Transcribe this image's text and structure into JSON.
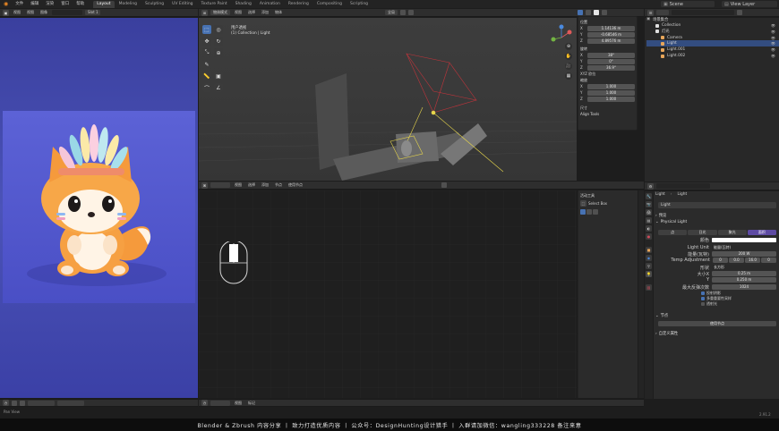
{
  "topbar": {
    "menus": [
      "文件",
      "编辑",
      "渲染",
      "窗口",
      "帮助"
    ],
    "workspace_tabs": [
      "Layout",
      "Modeling",
      "Sculpting",
      "UV Editing",
      "Texture Paint",
      "Shading",
      "Animation",
      "Rendering",
      "Compositing",
      "Scripting"
    ],
    "active_tab": "Layout",
    "scene_label": "Scene",
    "view_layer_label": "View Layer"
  },
  "left_editor": {
    "header_menus": [
      "视图",
      "视图",
      "图像"
    ],
    "slot_label": "Slot 1",
    "footer_status": "Pan View"
  },
  "viewport": {
    "header_mode": "物体模式",
    "header_menus": [
      "视图",
      "选择",
      "添加",
      "物体"
    ],
    "transform_label": "全局",
    "overlay_name": "用户透视",
    "overlay_collection": "(1) Collection | Light",
    "sidebar": {
      "location_title": "位置",
      "location": [
        [
          "X",
          "1.14136 m"
        ],
        [
          "Y",
          "-0.68546 m"
        ],
        [
          "Z",
          "4.89576 m"
        ]
      ],
      "rotation_title": "旋转",
      "rotation": [
        [
          "X",
          "38°"
        ],
        [
          "Y",
          "0°"
        ],
        [
          "Z",
          "36.9°"
        ]
      ],
      "mode_label": "XYZ 欧拉",
      "scale_title": "缩放",
      "scale": [
        [
          "X",
          "1.000"
        ],
        [
          "Y",
          "1.000"
        ],
        [
          "Z",
          "1.000"
        ]
      ],
      "dimensions_title": "尺寸",
      "align_tools": "Align Tools"
    }
  },
  "node_editor": {
    "header_menus": [
      "视图",
      "选择",
      "添加",
      "节点"
    ],
    "use_nodes": "使用节点",
    "side_panel_title": "活动工具",
    "side_panel_tool": "Select Box",
    "footer_menus": [
      "视图",
      "标记"
    ]
  },
  "outliner": {
    "title": "场景集合",
    "items": [
      {
        "name": "Collection",
        "indent": 1,
        "icon_color": "#e0e0e0"
      },
      {
        "name": "灯光",
        "indent": 1,
        "icon_color": "#e0e0e0"
      },
      {
        "name": "Camera",
        "indent": 2,
        "icon_color": "#e8a65a"
      },
      {
        "name": "Light",
        "indent": 2,
        "icon_color": "#e8a65a"
      },
      {
        "name": "Light.001",
        "indent": 2,
        "icon_color": "#e8a65a"
      },
      {
        "name": "Light.002",
        "indent": 2,
        "icon_color": "#e8a65a"
      }
    ],
    "selected_index": 3
  },
  "properties": {
    "breadcrumb_object": "Light",
    "breadcrumb_data": "Light",
    "datablock_name": "Light",
    "preview_label": "预览",
    "physical_light_label": "Physical Light",
    "light_types": [
      "点",
      "日光",
      "聚光",
      "面积"
    ],
    "active_light_type": "面积",
    "color_label": "颜色",
    "unit_label": "Light Unit",
    "unit_value": "能量(瓦特)",
    "power_label": "能量(瓦特)",
    "power_value": "200 W",
    "temp_label": "Temp Adjustment",
    "temp_values": [
      "0",
      "0.0",
      "16.0",
      "0"
    ],
    "shape_label": "形状",
    "shape_value": "长方形",
    "size_x_label": "大小X",
    "size_x_value": "0.25 m",
    "size_y_label": "Y",
    "size_y_value": "0.250 m",
    "distance_label": "最大反弹次数",
    "distance_value": "1024",
    "checkbox_labels": [
      "投射阴影",
      "多重重要性采样",
      "透射光"
    ],
    "section_lamp": "节点",
    "button_use_nodes": "使用节点",
    "section_custom": "自定义属性",
    "status_version": "2.91.2"
  },
  "caption": "Blender & Zbrush 内容分享  丨  致力打造优质内容  丨  公众号：DesignHunting设计猎手  丨  入群请加微信：wangling333228 备注来意",
  "colors": {
    "accent_blue": "#4772b3",
    "active_purple": "#5e4ba3",
    "render_bg_top": "#3c3f9b",
    "render_bg_bottom": "#3a3fb2",
    "light_wire_yellow": "#e7d64c"
  }
}
